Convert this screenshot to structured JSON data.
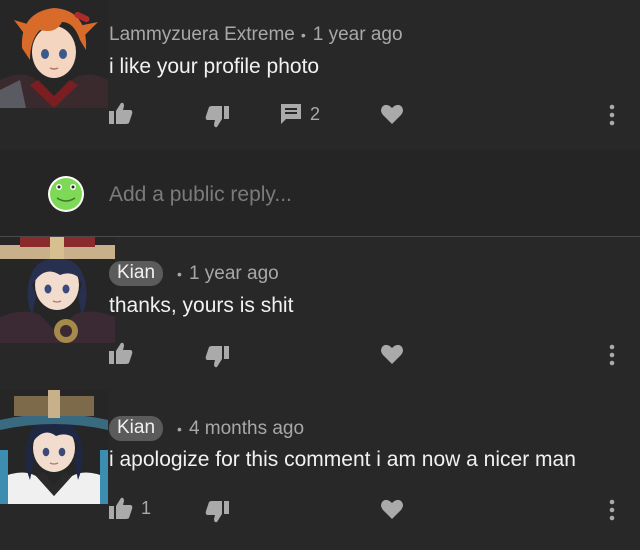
{
  "comments": [
    {
      "author": "Lammyzuera Extreme",
      "time": "1 year ago",
      "text": "i like your profile photo",
      "reply_count": "2",
      "author_highlighted": false,
      "avatar_icon": "orange-haired-character-avatar"
    },
    {
      "author": "Kian",
      "time": "1 year ago",
      "text": "thanks, yours is shit",
      "like_count": "",
      "author_highlighted": true,
      "avatar_icon": "hat-character-avatar"
    },
    {
      "author": "Kian",
      "time": "4 months ago",
      "text": "i apologize for this comment i am now a nicer man",
      "like_count": "1",
      "author_highlighted": true,
      "avatar_icon": "hat-character-avatar"
    }
  ],
  "reply_box": {
    "placeholder": "Add a public reply...",
    "avatar_icon": "green-frog-avatar"
  },
  "separator": "•",
  "colors": {
    "background": "#282828",
    "text_primary": "#f1f1f1",
    "text_secondary": "#a8a8a8",
    "icon": "#aaaaaa",
    "author_chip": "#5b5b5b",
    "frog_green": "#7ed957"
  }
}
